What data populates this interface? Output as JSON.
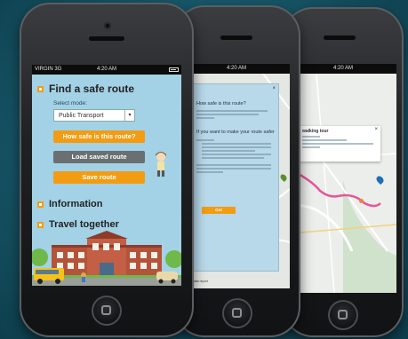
{
  "phone1": {
    "carrier": "VIRGIN 3G",
    "time": "4:20 AM",
    "find_route_title": "Find a safe route",
    "select_mode_label": "Select mode:",
    "mode_value": "Public Transport",
    "safe_button": "How safe is this route?",
    "load_button": "Load saved route",
    "save_button": "Save route",
    "information": "Information",
    "travel_together": "Travel together"
  },
  "phone2": {
    "time": "4:20 AM",
    "dialog_title": "How safe is this route?",
    "dialog_subtitle": "If you want to make your route safer",
    "ok_label": "Got",
    "footer_link": "Map data report"
  },
  "phone3": {
    "time": "4:20 AM",
    "popup_title": "walking tour"
  },
  "colors": {
    "accent": "#f39c12",
    "app_bg": "#a3d2e6",
    "route": "#e8559a"
  }
}
